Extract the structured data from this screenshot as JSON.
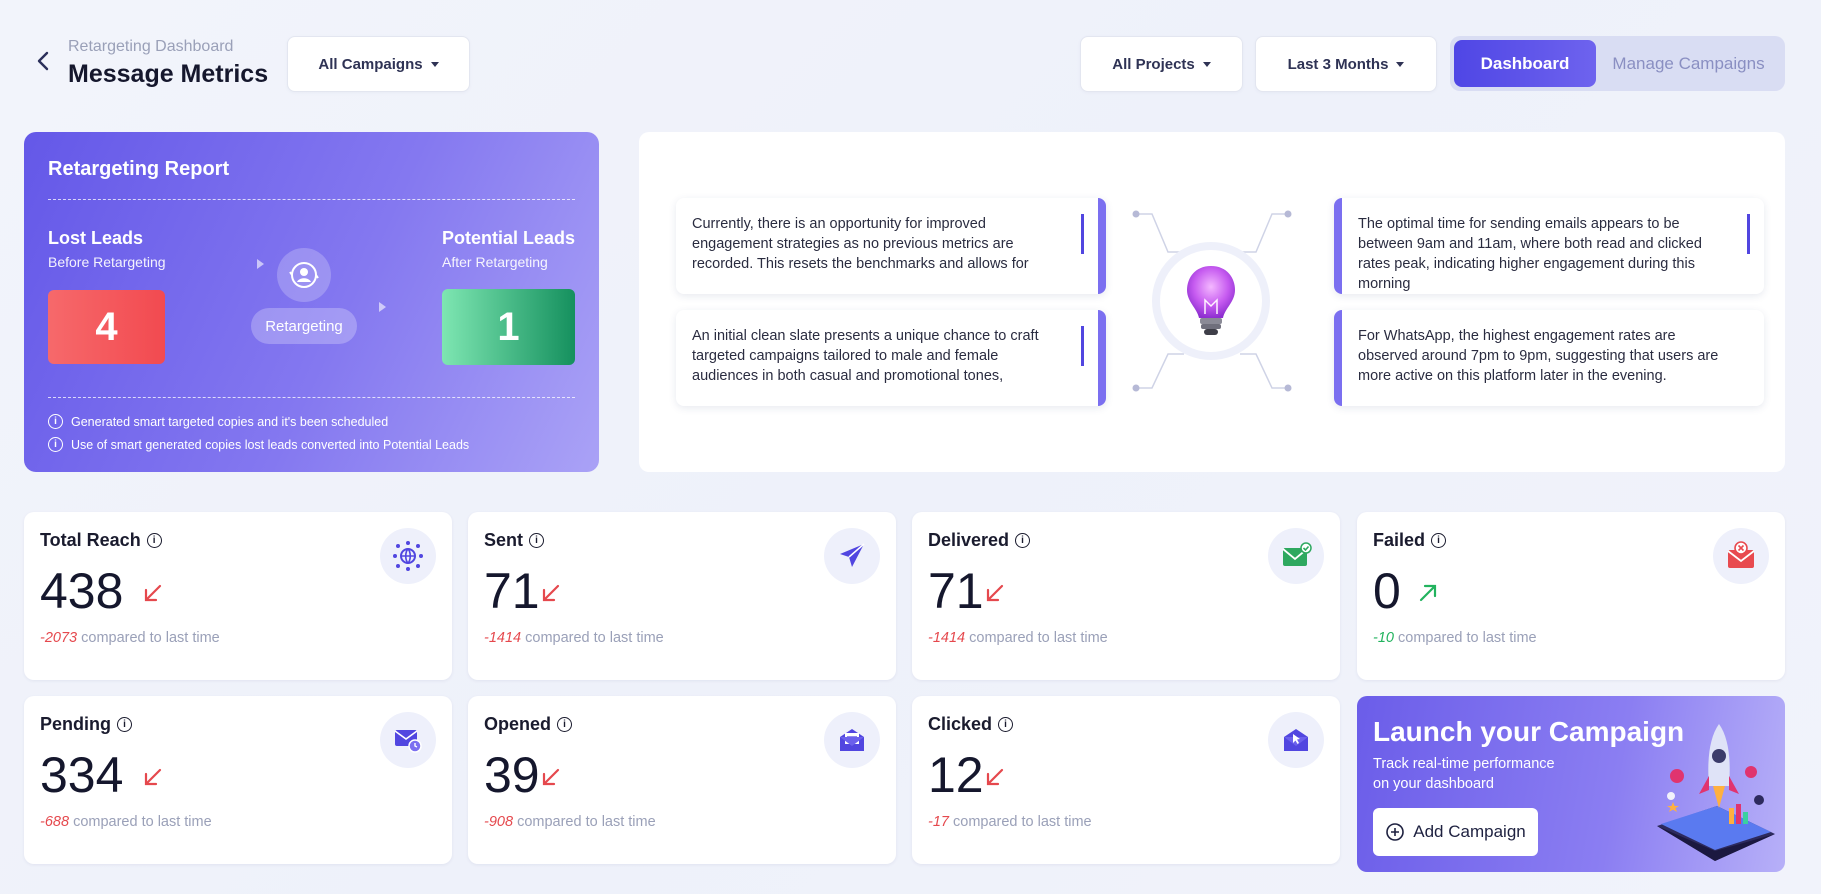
{
  "header": {
    "breadcrumb": "Retargeting Dashboard",
    "title": "Message Metrics",
    "campaign_filter": "All Campaigns",
    "project_filter": "All Projects",
    "period_filter": "Last 3 Months",
    "view_tabs": {
      "active": "Dashboard",
      "inactive": "Manage Campaigns"
    }
  },
  "report": {
    "title": "Retargeting Report",
    "lost": {
      "heading": "Lost Leads",
      "sub": "Before Retargeting",
      "value": "4"
    },
    "middle_label": "Retargeting",
    "potential": {
      "heading": "Potential Leads",
      "sub": "After Retargeting",
      "value": "1"
    },
    "notes": [
      "Generated smart targeted copies and it's been scheduled",
      "Use of smart generated copies lost leads converted into Potential Leads"
    ]
  },
  "insights": [
    "Currently, there is an opportunity for improved engagement strategies as no previous metrics are recorded. This resets the benchmarks and allows for",
    "An initial clean slate presents a unique chance to craft targeted campaigns tailored to male and female audiences in both casual and promotional tones,",
    "The optimal time for sending emails appears to be between 9am and 11am, where both read and clicked rates peak, indicating higher engagement during this morning",
    "For WhatsApp, the highest engagement rates are observed around 7pm to 9pm, suggesting that users are more active on this platform later in the evening."
  ],
  "metrics": [
    {
      "label": "Total Reach",
      "value": "438",
      "delta": "-2073",
      "suffix": "compared to last time",
      "trend": "down",
      "icon": "globe-network-icon"
    },
    {
      "label": "Sent",
      "value": "71",
      "delta": "-1414",
      "suffix": "compared to last time",
      "trend": "down",
      "icon": "paper-plane-icon"
    },
    {
      "label": "Delivered",
      "value": "71",
      "delta": "-1414",
      "suffix": "compared to last time",
      "trend": "down",
      "icon": "envelope-check-icon"
    },
    {
      "label": "Failed",
      "value": "0",
      "delta": "-10",
      "suffix": "compared to last time",
      "trend": "up",
      "icon": "envelope-x-icon"
    },
    {
      "label": "Pending",
      "value": "334",
      "delta": "-688",
      "suffix": "compared to last time",
      "trend": "down",
      "icon": "envelope-clock-icon"
    },
    {
      "label": "Opened",
      "value": "39",
      "delta": "-908",
      "suffix": "compared to last time",
      "trend": "down",
      "icon": "envelope-open-icon"
    },
    {
      "label": "Clicked",
      "value": "12",
      "delta": "-17",
      "suffix": "compared to last time",
      "trend": "down",
      "icon": "envelope-cursor-icon"
    }
  ],
  "launch": {
    "title": "Launch your Campaign",
    "subtitle": "Track real-time performance on your dashboard",
    "button": "Add Campaign"
  },
  "colors": {
    "accent": "#4f46e5",
    "down": "#e5484d",
    "up": "#22b35e",
    "lost_box": "#f5565a",
    "potential_box": "#2fb077"
  }
}
